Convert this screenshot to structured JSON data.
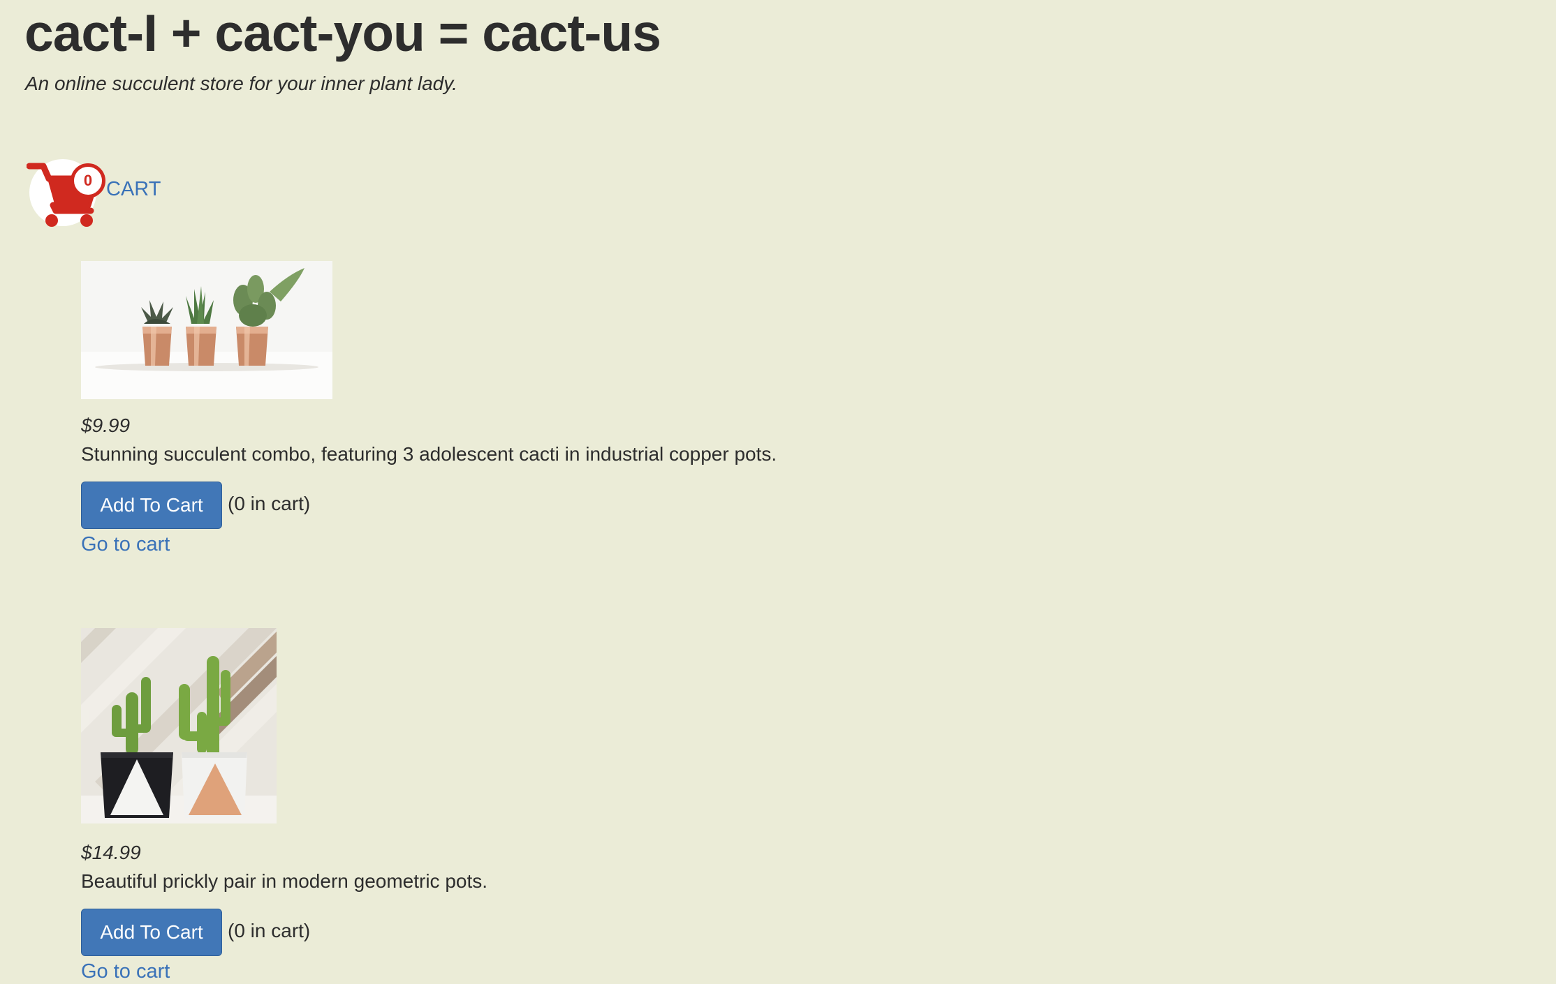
{
  "header": {
    "title": "cact-I + cact-you = cact-us",
    "subtitle": "An online succulent store for your inner plant lady."
  },
  "cart": {
    "count": "0",
    "label": "CART",
    "icon": "shopping-cart-icon"
  },
  "colors": {
    "background": "#ebecd7",
    "accent_red": "#d0291f",
    "link_blue": "#3a72b8",
    "button_blue": "#4177b7"
  },
  "products": [
    {
      "image": "three-cacti-copper-pots",
      "price": "$9.99",
      "description": "Stunning succulent combo, featuring 3 adolescent cacti in industrial copper pots.",
      "button_label": "Add To Cart",
      "in_cart": "(0 in cart)",
      "link_label": "Go to cart"
    },
    {
      "image": "two-cacti-geometric-pots",
      "price": "$14.99",
      "description": "Beautiful prickly pair in modern geometric pots.",
      "button_label": "Add To Cart",
      "in_cart": "(0 in cart)",
      "link_label": "Go to cart"
    }
  ]
}
